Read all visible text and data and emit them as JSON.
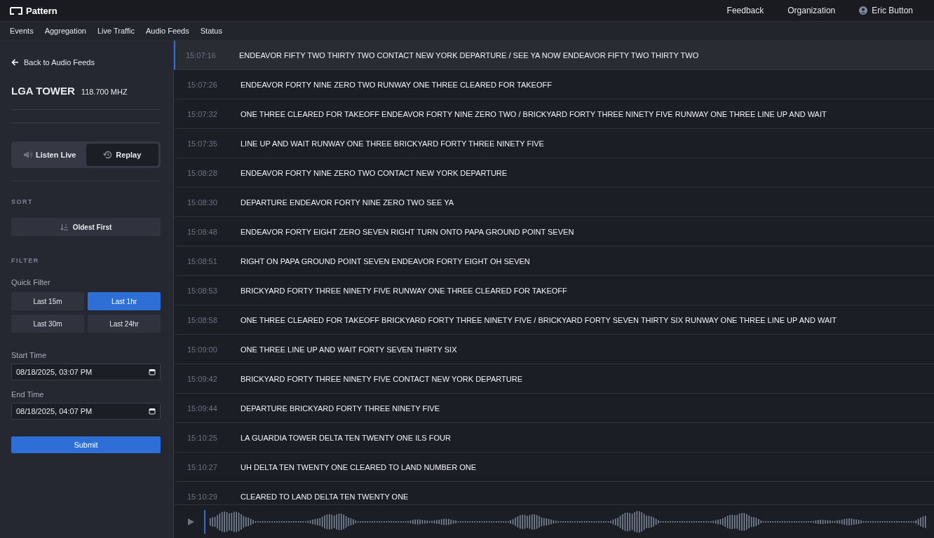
{
  "app": {
    "name": "Pattern"
  },
  "top_links": [
    {
      "label": "Feedback",
      "kind": "link"
    },
    {
      "label": "Organization",
      "kind": "link"
    },
    {
      "label": "Eric Button",
      "kind": "user"
    }
  ],
  "nav": [
    {
      "label": "Events"
    },
    {
      "label": "Aggregation"
    },
    {
      "label": "Live Traffic"
    },
    {
      "label": "Audio Feeds"
    },
    {
      "label": "Status"
    }
  ],
  "sidebar": {
    "back": "Back to Audio Feeds",
    "title": "LGA TOWER",
    "frequency": "118.700 MHZ",
    "modes": [
      {
        "label": "Listen Live",
        "kind": "live",
        "selected": false
      },
      {
        "label": "Replay",
        "kind": "replay",
        "selected": true
      }
    ],
    "sort_heading": "SORT",
    "sort_button": "Oldest First",
    "filter_heading": "FILTER",
    "quick_filter_label": "Quick Filter",
    "quick_filters": [
      {
        "label": "Last 15m",
        "selected": false
      },
      {
        "label": "Last 1hr",
        "selected": true
      },
      {
        "label": "Last 30m",
        "selected": false
      },
      {
        "label": "Last 24hr",
        "selected": false
      }
    ],
    "start_label": "Start Time",
    "start_value": "08/18/2025, 03:07 PM",
    "end_label": "End Time",
    "end_value": "08/18/2025, 04:07 PM",
    "submit": "Submit"
  },
  "transcripts": [
    {
      "time": "15:07:16",
      "text": "ENDEAVOR FIFTY TWO THIRTY TWO CONTACT NEW YORK DEPARTURE / SEE YA NOW ENDEAVOR FIFTY TWO THIRTY TWO",
      "selected": true
    },
    {
      "time": "15:07:26",
      "text": "ENDEAVOR FORTY NINE ZERO TWO RUNWAY ONE THREE CLEARED FOR TAKEOFF",
      "selected": false
    },
    {
      "time": "15:07:32",
      "text": "ONE THREE CLEARED FOR TAKEOFF ENDEAVOR FORTY NINE ZERO TWO / BRICKYARD FORTY THREE NINETY FIVE RUNWAY ONE THREE LINE UP AND WAIT",
      "selected": false
    },
    {
      "time": "15:07:35",
      "text": "LINE UP AND WAIT RUNWAY ONE THREE BRICKYARD FORTY THREE NINETY FIVE",
      "selected": false
    },
    {
      "time": "15:08:28",
      "text": "ENDEAVOR FORTY NINE ZERO TWO CONTACT NEW YORK DEPARTURE",
      "selected": false
    },
    {
      "time": "15:08:30",
      "text": "DEPARTURE ENDEAVOR FORTY NINE ZERO TWO SEE YA",
      "selected": false
    },
    {
      "time": "15:08:48",
      "text": "ENDEAVOR FORTY EIGHT ZERO SEVEN RIGHT TURN ONTO PAPA GROUND POINT SEVEN",
      "selected": false
    },
    {
      "time": "15:08:51",
      "text": "RIGHT ON PAPA GROUND POINT SEVEN ENDEAVOR FORTY EIGHT OH SEVEN",
      "selected": false
    },
    {
      "time": "15:08:53",
      "text": "BRICKYARD FORTY THREE NINETY FIVE RUNWAY ONE THREE CLEARED FOR TAKEOFF",
      "selected": false
    },
    {
      "time": "15:08:58",
      "text": "ONE THREE CLEARED FOR TAKEOFF BRICKYARD FORTY THREE NINETY FIVE / BRICKYARD FORTY SEVEN THIRTY SIX RUNWAY ONE THREE LINE UP AND WAIT",
      "selected": false
    },
    {
      "time": "15:09:00",
      "text": "ONE THREE LINE UP AND WAIT FORTY SEVEN THIRTY SIX",
      "selected": false
    },
    {
      "time": "15:09:42",
      "text": "BRICKYARD FORTY THREE NINETY FIVE CONTACT NEW YORK DEPARTURE",
      "selected": false
    },
    {
      "time": "15:09:44",
      "text": "DEPARTURE BRICKYARD FORTY THREE NINETY FIVE",
      "selected": false
    },
    {
      "time": "15:10:25",
      "text": "LA GUARDIA TOWER DELTA TEN TWENTY ONE ILS FOUR",
      "selected": false
    },
    {
      "time": "15:10:27",
      "text": "UH DELTA TEN TWENTY ONE CLEARED TO LAND NUMBER ONE",
      "selected": false
    },
    {
      "time": "15:10:29",
      "text": "CLEARED TO LAND DELTA TEN TWENTY ONE",
      "selected": false
    }
  ]
}
